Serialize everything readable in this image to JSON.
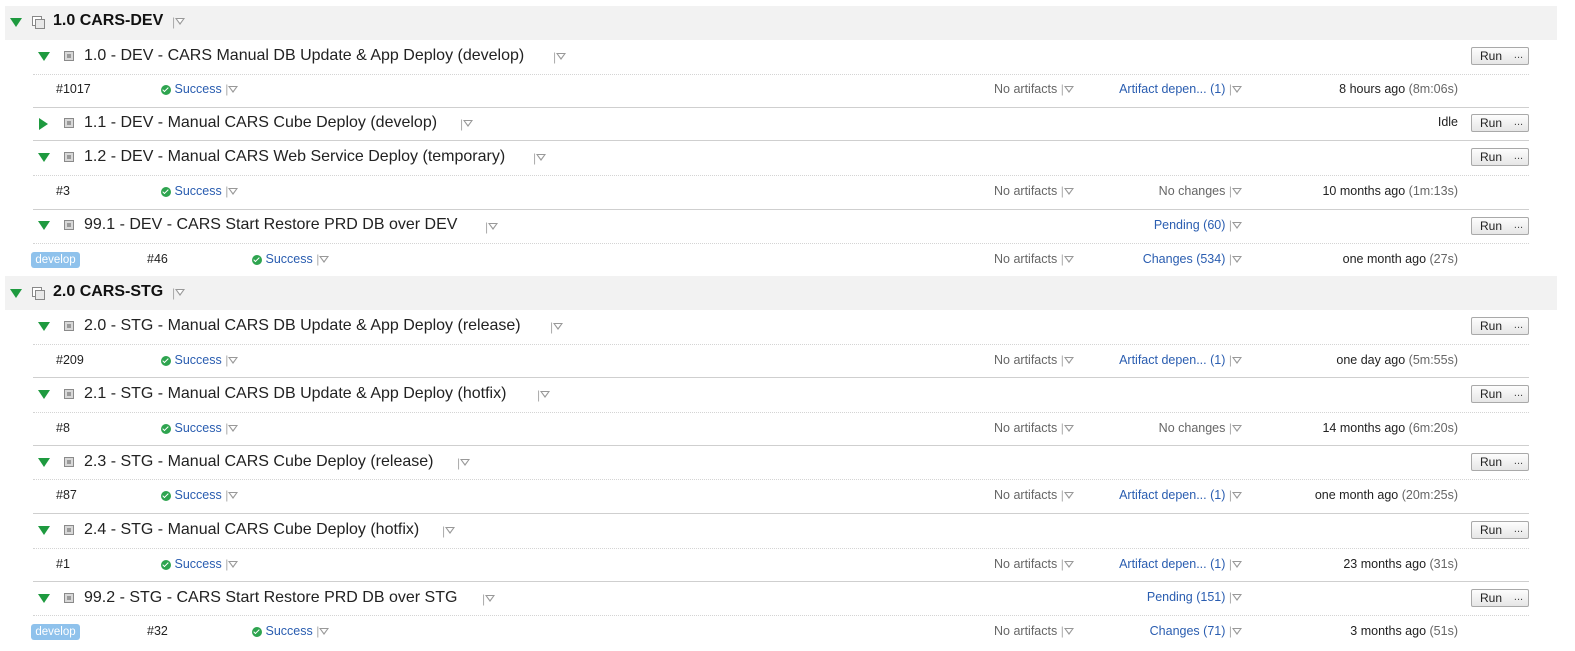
{
  "projects": [
    {
      "title": "1.0 CARS-DEV",
      "build_types": [
        {
          "name": "1.0 - DEV - CARS Manual DB Update & App Deploy (develop)",
          "expanded": true,
          "run_label": "Run",
          "more_label": "...",
          "build": {
            "number": "#1017",
            "status": "Success",
            "artifacts": "No artifacts",
            "changes": "Artifact depen... (1)",
            "time": "8 hours ago",
            "duration": "(8m:06s)"
          }
        },
        {
          "name": "1.1 - DEV - Manual CARS Cube Deploy (develop)",
          "expanded": false,
          "state": "Idle",
          "run_label": "Run",
          "more_label": "..."
        },
        {
          "name": "1.2 - DEV - Manual CARS Web Service Deploy (temporary)",
          "expanded": true,
          "run_label": "Run",
          "more_label": "...",
          "build": {
            "number": "#3",
            "status": "Success",
            "artifacts": "No artifacts",
            "changes": "No changes",
            "time": "10 months ago",
            "duration": "(1m:13s)"
          }
        },
        {
          "name": "99.1 - DEV - CARS Start Restore PRD DB over DEV",
          "expanded": true,
          "pending": "Pending (60)",
          "run_label": "Run",
          "more_label": "...",
          "build": {
            "branch": "develop",
            "number": "#46",
            "status": "Success",
            "artifacts": "No artifacts",
            "changes": "Changes (534)",
            "time": "one month ago",
            "duration": "(27s)"
          }
        }
      ]
    },
    {
      "title": "2.0 CARS-STG",
      "build_types": [
        {
          "name": "2.0 - STG - Manual CARS DB Update & App Deploy (release)",
          "expanded": true,
          "run_label": "Run",
          "more_label": "...",
          "build": {
            "number": "#209",
            "status": "Success",
            "artifacts": "No artifacts",
            "changes": "Artifact depen... (1)",
            "time": "one day ago",
            "duration": "(5m:55s)"
          }
        },
        {
          "name": "2.1 - STG - Manual CARS DB Update & App Deploy (hotfix)",
          "expanded": true,
          "run_label": "Run",
          "more_label": "...",
          "build": {
            "number": "#8",
            "status": "Success",
            "artifacts": "No artifacts",
            "changes": "No changes",
            "time": "14 months ago",
            "duration": "(6m:20s)"
          }
        },
        {
          "name": "2.3 - STG - Manual CARS Cube Deploy (release)",
          "expanded": true,
          "run_label": "Run",
          "more_label": "...",
          "build": {
            "number": "#87",
            "status": "Success",
            "artifacts": "No artifacts",
            "changes": "Artifact depen... (1)",
            "time": "one month ago",
            "duration": "(20m:25s)"
          }
        },
        {
          "name": "2.4 - STG - Manual CARS Cube Deploy (hotfix)",
          "expanded": true,
          "run_label": "Run",
          "more_label": "...",
          "build": {
            "number": "#1",
            "status": "Success",
            "artifacts": "No artifacts",
            "changes": "Artifact depen... (1)",
            "time": "23 months ago",
            "duration": "(31s)"
          }
        },
        {
          "name": "99.2 - STG - CARS Start Restore PRD DB over STG",
          "expanded": true,
          "pending": "Pending (151)",
          "run_label": "Run",
          "more_label": "...",
          "build": {
            "branch": "develop",
            "number": "#32",
            "status": "Success",
            "artifacts": "No artifacts",
            "changes": "Changes (71)",
            "time": "3 months ago",
            "duration": "(51s)"
          }
        }
      ]
    }
  ],
  "icons": {
    "collapse": "triangle-down-icon",
    "expand": "triangle-right-icon",
    "project": "project-icon",
    "build_type": "build-config-icon",
    "success": "success-check-icon",
    "dropdown": "dropdown-arrow-icon"
  },
  "colors": {
    "toggle": "#1e9a3f",
    "link": "#2a5db0",
    "success": "#2ea44f",
    "branch_badge": "#8fc2ec",
    "project_bar": "#f2f2f2"
  }
}
